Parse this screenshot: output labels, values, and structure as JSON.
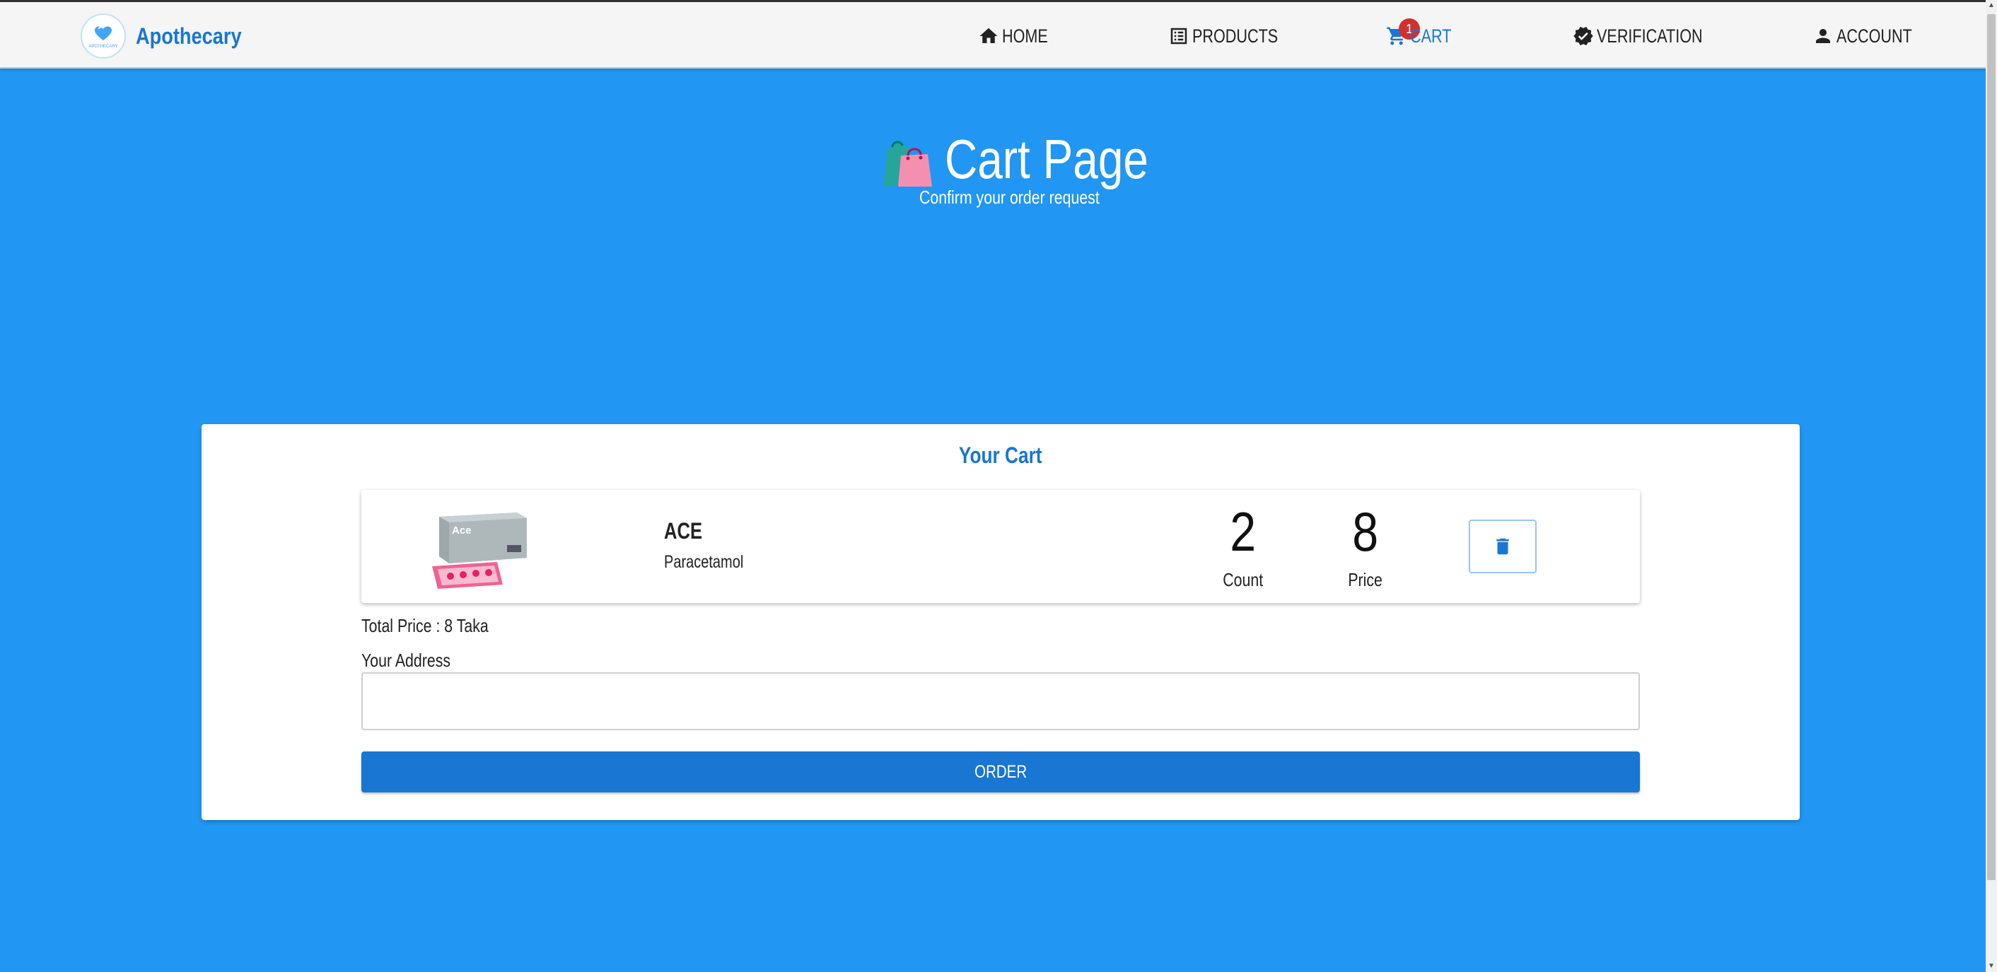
{
  "navbar": {
    "brand": "Apothecary",
    "brand_logo_text": "APOTHECARY",
    "items": [
      {
        "label": "Home",
        "icon": "home-icon"
      },
      {
        "label": "Products",
        "icon": "list-icon"
      },
      {
        "label": "Cart",
        "icon": "cart-icon",
        "badge": "1",
        "active": true
      },
      {
        "label": "Verification",
        "icon": "verified-icon"
      },
      {
        "label": "Account",
        "icon": "person-icon"
      }
    ]
  },
  "header": {
    "title": "Cart Page",
    "subtitle": "Confirm your order request",
    "icon": "shopping-bags-icon"
  },
  "cart": {
    "title": "Your Cart",
    "items": [
      {
        "name": "ACE",
        "generic": "Paracetamol",
        "count": "2",
        "count_label": "Count",
        "price": "8",
        "price_label": "Price",
        "image_label": "Ace"
      }
    ],
    "total_price": "Total Price : 8 Taka",
    "address_label": "Your Address",
    "address_value": "",
    "order_button": "ORDER"
  },
  "colors": {
    "page_bg": "#2196f3",
    "accent": "#1976d2",
    "badge": "#d32f2f",
    "navbar_bg": "#f5f5f5"
  }
}
